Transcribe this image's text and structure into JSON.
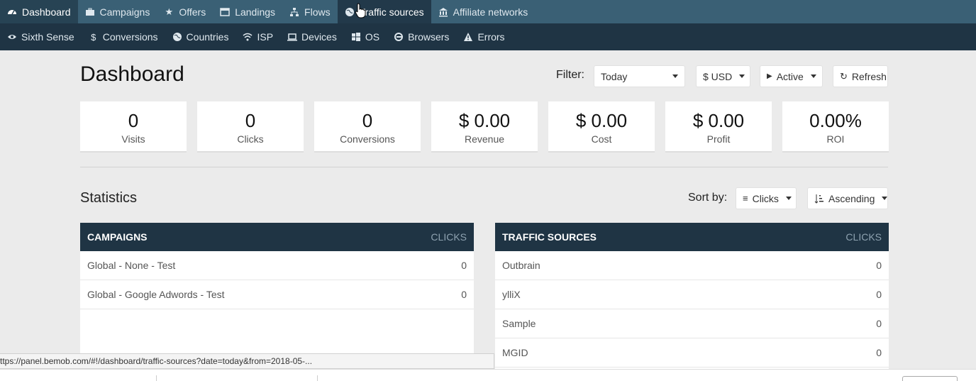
{
  "nav_primary": [
    {
      "label": "Dashboard",
      "icon": "dashboard-icon"
    },
    {
      "label": "Campaigns",
      "icon": "briefcase-icon"
    },
    {
      "label": "Offers",
      "icon": "star-icon"
    },
    {
      "label": "Landings",
      "icon": "window-icon"
    },
    {
      "label": "Flows",
      "icon": "sitemap-icon"
    },
    {
      "label": "Traffic sources",
      "icon": "globe-icon"
    },
    {
      "label": "Affiliate networks",
      "icon": "bank-icon"
    }
  ],
  "nav_secondary": [
    {
      "label": "Sixth Sense",
      "icon": "eye-icon"
    },
    {
      "label": "Conversions",
      "icon": "dollar-icon"
    },
    {
      "label": "Countries",
      "icon": "globe-icon"
    },
    {
      "label": "ISP",
      "icon": "wifi-icon"
    },
    {
      "label": "Devices",
      "icon": "laptop-icon"
    },
    {
      "label": "OS",
      "icon": "windows-icon"
    },
    {
      "label": "Browsers",
      "icon": "browser-icon"
    },
    {
      "label": "Errors",
      "icon": "warning-icon"
    }
  ],
  "header": {
    "title": "Dashboard",
    "filter_label": "Filter:",
    "date_filter": "Today",
    "currency": "$ USD",
    "status": "Active",
    "refresh": "Refresh"
  },
  "stats": [
    {
      "value": "0",
      "label": "Visits"
    },
    {
      "value": "0",
      "label": "Clicks"
    },
    {
      "value": "0",
      "label": "Conversions"
    },
    {
      "value": "$ 0.00",
      "label": "Revenue"
    },
    {
      "value": "$ 0.00",
      "label": "Cost"
    },
    {
      "value": "$ 0.00",
      "label": "Profit"
    },
    {
      "value": "0.00%",
      "label": "ROI"
    }
  ],
  "statistics": {
    "title": "Statistics",
    "sort_label": "Sort by:",
    "sort_field": "Clicks",
    "sort_order": "Ascending"
  },
  "campaigns_panel": {
    "title": "CAMPAIGNS",
    "column": "CLICKS",
    "rows": [
      {
        "name": "Global - None - Test",
        "clicks": "0"
      },
      {
        "name": "Global - Google Adwords - Test",
        "clicks": "0"
      }
    ]
  },
  "traffic_panel": {
    "title": "TRAFFIC SOURCES",
    "column": "CLICKS",
    "rows": [
      {
        "name": "Outbrain",
        "clicks": "0"
      },
      {
        "name": "ylliX",
        "clicks": "0"
      },
      {
        "name": "Sample",
        "clicks": "0"
      },
      {
        "name": "MGID",
        "clicks": "0"
      }
    ]
  },
  "status_bar": "ttps://panel.bemob.com/#!/dashboard/traffic-sources?date=today&from=2018-05-..."
}
